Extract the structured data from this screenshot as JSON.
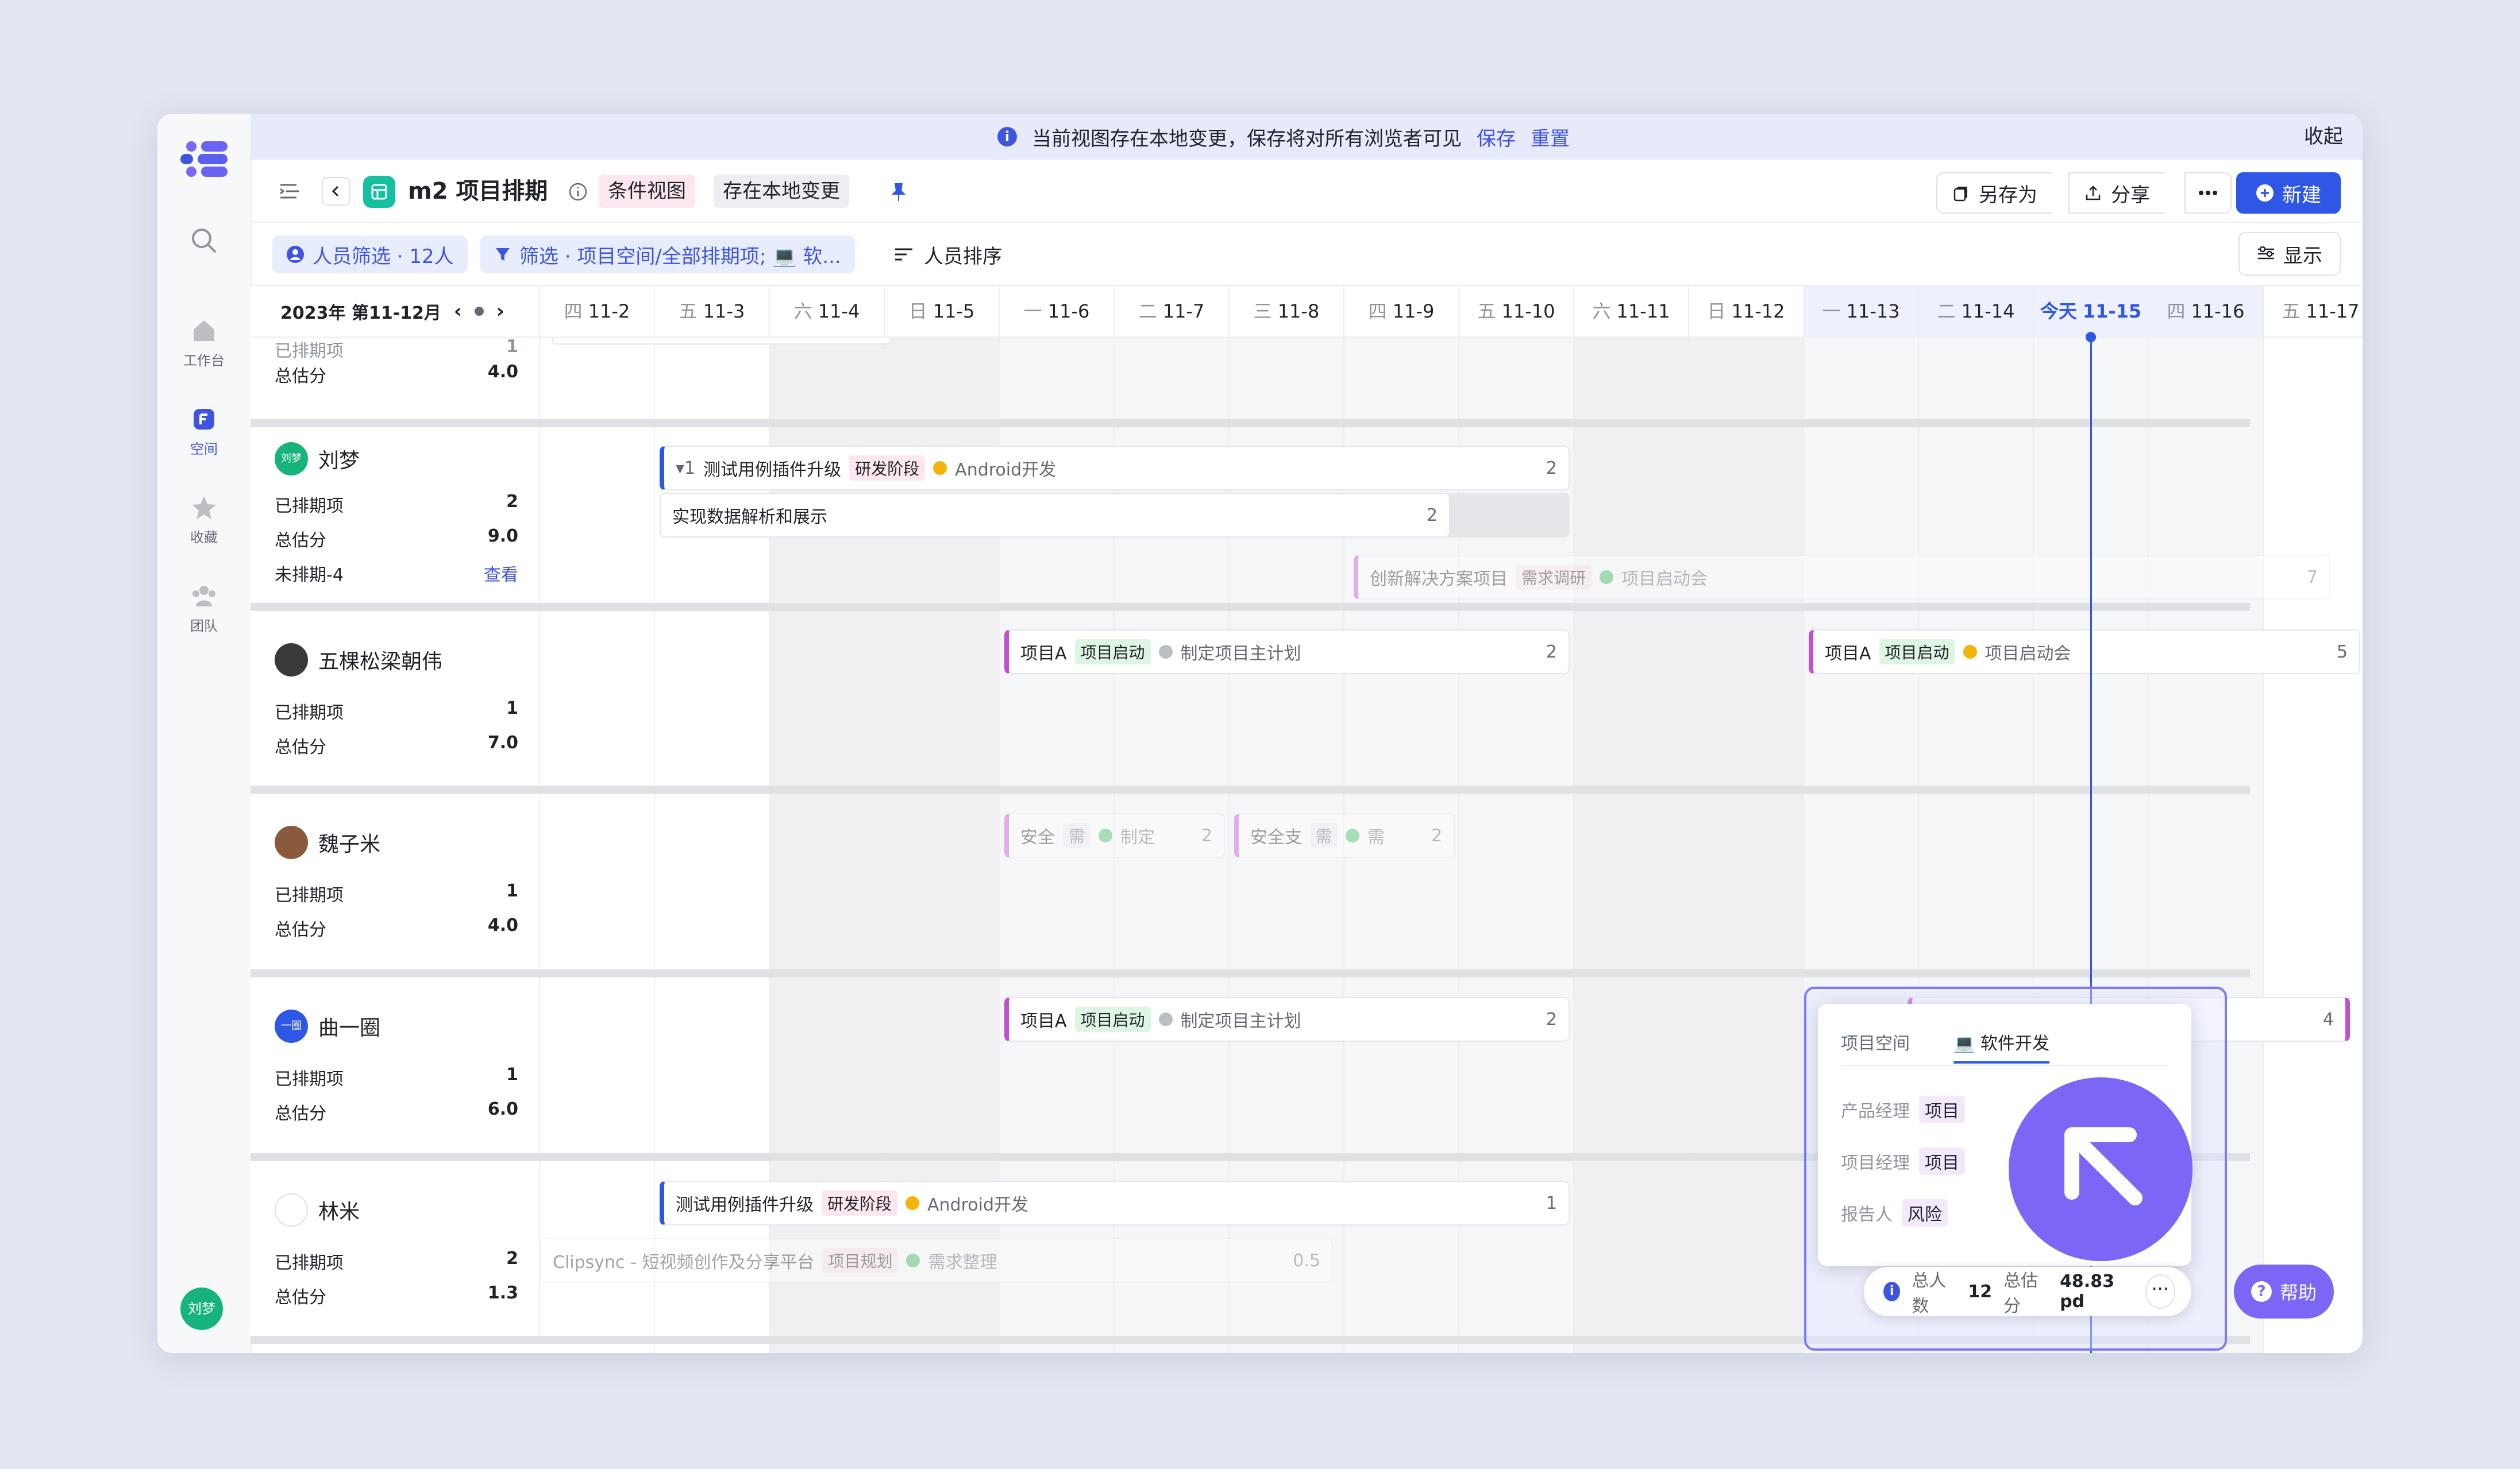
{
  "banner": {
    "message": "当前视图存在本地变更，保存将对所有浏览者可见",
    "save": "保存",
    "reset": "重置",
    "collapse": "收起"
  },
  "rail": {
    "workbench": "工作台",
    "space": "空间",
    "favorites": "收藏",
    "team": "团队",
    "user_avatar": "刘梦"
  },
  "toolbar": {
    "title": "m2 项目排期",
    "cond_view": "条件视图",
    "local_change": "存在本地变更",
    "save_as": "另存为",
    "share": "分享",
    "new": "新建"
  },
  "filters": {
    "people_filter": "人员筛选 · 12人",
    "filter": "筛选 · 项目空间/全部排期项; 💻 软...",
    "sort": "人员排序",
    "display": "显示"
  },
  "calendar": {
    "range_label": "2023年 第11-12月",
    "days": [
      {
        "wd": "四",
        "d": "11-2"
      },
      {
        "wd": "五",
        "d": "11-3"
      },
      {
        "wd": "六",
        "d": "11-4"
      },
      {
        "wd": "日",
        "d": "11-5"
      },
      {
        "wd": "一",
        "d": "11-6"
      },
      {
        "wd": "二",
        "d": "11-7"
      },
      {
        "wd": "三",
        "d": "11-8"
      },
      {
        "wd": "四",
        "d": "11-9"
      },
      {
        "wd": "五",
        "d": "11-10"
      },
      {
        "wd": "六",
        "d": "11-11"
      },
      {
        "wd": "日",
        "d": "11-12"
      },
      {
        "wd": "一",
        "d": "11-13"
      },
      {
        "wd": "二",
        "d": "11-14"
      },
      {
        "wd": "今天",
        "d": "11-15"
      },
      {
        "wd": "四",
        "d": "11-16"
      },
      {
        "wd": "五",
        "d": "11-17"
      }
    ]
  },
  "labels": {
    "scheduled": "已排期项",
    "estimate": "总估分",
    "unscheduled": "未排期-4",
    "view": "查看"
  },
  "people": [
    {
      "name": "",
      "scheduled": "1",
      "estimate": "4.0"
    },
    {
      "name": "刘梦",
      "avatar": "刘梦",
      "scheduled": "2",
      "estimate": "9.0"
    },
    {
      "name": "五棵松梁朝伟",
      "scheduled": "1",
      "estimate": "7.0"
    },
    {
      "name": "魏子米",
      "scheduled": "1",
      "estimate": "4.0"
    },
    {
      "name": "曲一圈",
      "avatar": "一圈",
      "scheduled": "1",
      "estimate": "6.0"
    },
    {
      "name": "林米",
      "scheduled": "2",
      "estimate": "1.3"
    }
  ],
  "bars": {
    "b1": {
      "prefix": "▾1",
      "title": "测试用例插件升级",
      "tag": "研发阶段",
      "status": "Android开发",
      "num": "2"
    },
    "b2": {
      "title": "实现数据解析和展示",
      "num": "2"
    },
    "b3": {
      "title": "创新解决方案项目",
      "tag": "需求调研",
      "status": "项目启动会",
      "num": "7"
    },
    "b4": {
      "title": "项目A",
      "tag": "项目启动",
      "status": "制定项目主计划",
      "num": "2"
    },
    "b5": {
      "title": "项目A",
      "tag": "项目启动",
      "status": "项目启动会",
      "num": "5"
    },
    "b6": {
      "title": "安全",
      "tag": "需",
      "status": "制定",
      "num": "2"
    },
    "b7": {
      "title": "安全支",
      "tag": "需",
      "status": "需",
      "num": "2"
    },
    "b8": {
      "title": "项目A",
      "tag": "项目启动",
      "status": "制定项目主计划",
      "num": "2"
    },
    "b9": {
      "num": "4"
    },
    "b10": {
      "title": "测试用例插件升级",
      "tag": "研发阶段",
      "status": "Android开发",
      "num": "1"
    },
    "b11": {
      "title": "Clipsync - 短视频创作及分享平台",
      "tag": "项目规划",
      "status": "需求整理",
      "num": "0.5"
    }
  },
  "popup": {
    "tab1": "项目空间",
    "tab2": "💻 软件开发",
    "row1_label": "产品经理",
    "row1_val": "项目",
    "row2_label": "项目经理",
    "row2_val": "项目",
    "row3_label": "报告人",
    "row3_val": "风险"
  },
  "summary": {
    "people_label": "总人数",
    "people_val": "12",
    "est_label": "总估分",
    "est_val": "48.83 pd"
  },
  "help": "帮助",
  "colors": {
    "accent": "#2f57e6",
    "purple": "#7c66f5",
    "magenta": "#c24fd1",
    "green": "#3dbb61",
    "yellow": "#f5b40a",
    "gray": "#bbbfc4"
  }
}
